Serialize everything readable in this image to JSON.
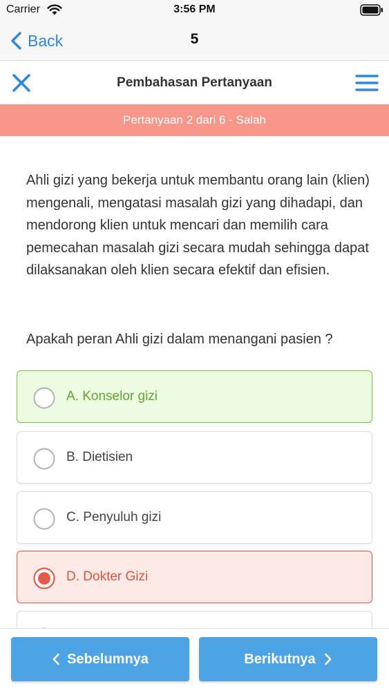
{
  "status_bar": {
    "carrier": "Carrier",
    "time": "3:56 PM"
  },
  "nav": {
    "back_label": "Back",
    "title": "5"
  },
  "header": {
    "title": "Pembahasan Pertanyaan"
  },
  "banner": {
    "text": "Pertanyaan 2 dari 6 - Salah",
    "color": "#f9968a"
  },
  "question": {
    "text": "Ahli gizi yang bekerja untuk membantu orang lain (klien) mengenali, mengatasi masalah gizi yang dihadapi, dan mendorong klien untuk mencari dan memilih cara pemecahan masalah gizi secara mudah sehingga dapat dilaksanakan oleh klien secara efektif dan efisien.",
    "prompt": "Apakah peran Ahli gizi dalam menangani pasien ?"
  },
  "options": [
    {
      "label": "A. Konselor gizi",
      "state": "correct"
    },
    {
      "label": "B. Dietisien",
      "state": "neutral"
    },
    {
      "label": "C. Penyuluh gizi",
      "state": "neutral"
    },
    {
      "label": "D. Dokter Gizi",
      "state": "selected-wrong"
    }
  ],
  "footer": {
    "prev_label": "Sebelumnya",
    "next_label": "Berikutnya"
  },
  "colors": {
    "accent": "#2f86e0",
    "button": "#4ea3e4",
    "correct": "#7cc242",
    "wrong": "#e55a4a"
  }
}
